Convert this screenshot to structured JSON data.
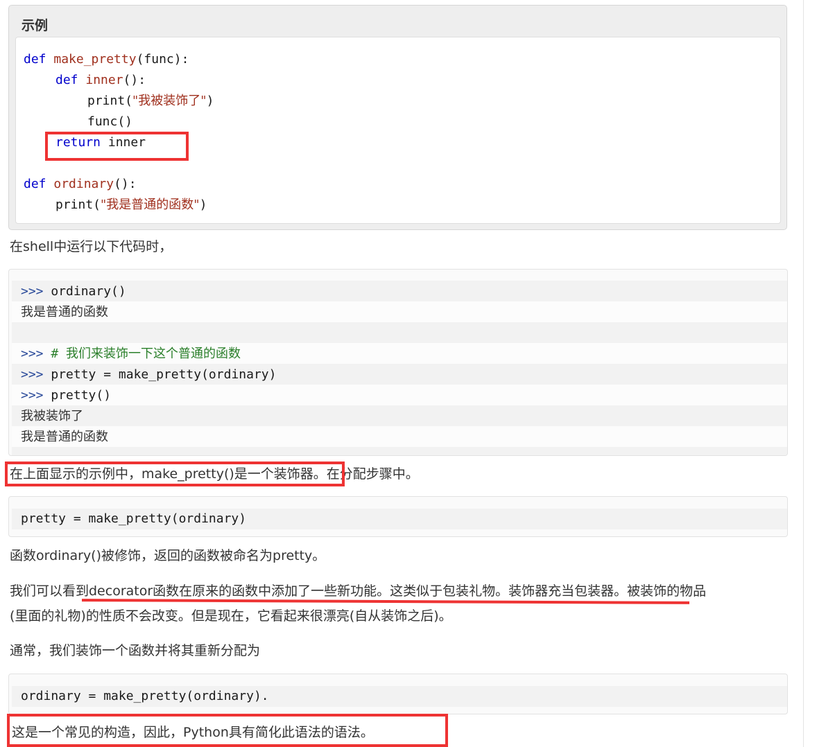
{
  "example": {
    "title": "示例",
    "code": {
      "l1": {
        "kw": "def",
        "name": "make_pretty",
        "rest": "(func):"
      },
      "l2": {
        "kw": "def",
        "name": "inner",
        "rest": "():"
      },
      "l3": {
        "call": "print(",
        "str": "\"我被装饰了\"",
        "close": ")"
      },
      "l4": "func()",
      "l5": {
        "kw": "return",
        "rest": " inner"
      },
      "l6": {
        "kw": "def",
        "name": "ordinary",
        "rest": "():"
      },
      "l7": {
        "call": "print(",
        "str": "\"我是普通的函数\"",
        "close": ")"
      }
    }
  },
  "para1": "在shell中运行以下代码时，",
  "shell1": {
    "prompt": ">>>",
    "line1": "ordinary()",
    "out1": "我是普通的函数",
    "comment": "# 我们来装饰一下这个普通的函数",
    "line2": "pretty = make_pretty(ordinary)",
    "line3": "pretty()",
    "out2": "我被装饰了",
    "out3": "我是普通的函数"
  },
  "para2": {
    "boxed": "在上面显示的示例中，make_pretty()是一个装饰器。",
    "rest": "在分配步骤中。"
  },
  "code2": "pretty = make_pretty(ordinary)",
  "para3": "函数ordinary()被修饰，返回的函数被命名为pretty。",
  "para4": {
    "line1": "我们可以看到decorator函数在原来的函数中添加了一些新功能。这类似于包装礼物。装饰器充当包装器。被装饰的物品",
    "line2": "(里面的礼物)的性质不会改变。但是现在，它看起来很漂亮(自从装饰之后)。"
  },
  "para5": "通常，我们装饰一个函数并将其重新分配为",
  "code3": "ordinary = make_pretty(ordinary).",
  "para6": "这是一个常见的构造，因此，Python具有简化此语法的语法。",
  "annotation_color": "#ee3333"
}
